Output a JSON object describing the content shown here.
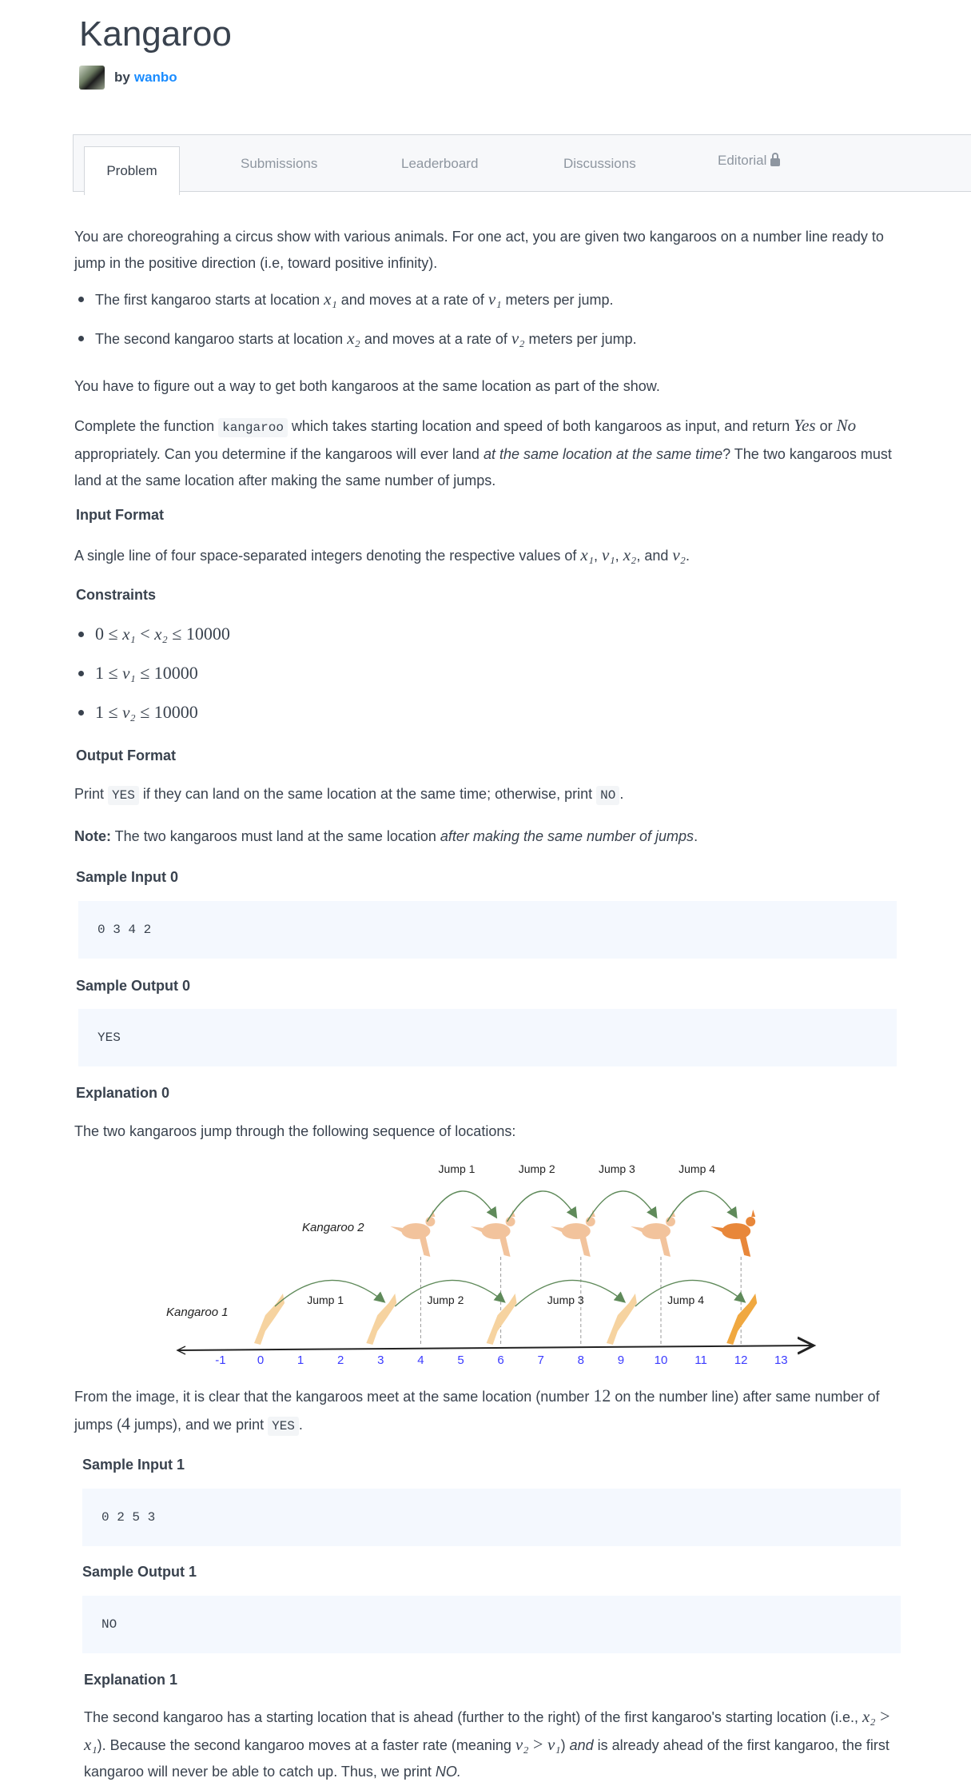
{
  "header": {
    "title": "Kangaroo",
    "by": "by",
    "author": "wanbo"
  },
  "tabs": [
    {
      "label": "Problem"
    },
    {
      "label": "Submissions"
    },
    {
      "label": "Leaderboard"
    },
    {
      "label": "Discussions"
    },
    {
      "label": "Editorial",
      "icon": "lock-icon"
    }
  ],
  "problem": {
    "intro": [
      {
        "t": "You are choreograhing a circus show with various animals. For one act, you are given two kangaroos on a number line ready to jump in the positive direction (i.e, toward positive infinity)."
      }
    ],
    "bullets": [
      [
        {
          "t": "The first kangaroo starts at location "
        },
        {
          "t": "x₁",
          "s": "m"
        },
        {
          "t": " and moves at a rate of "
        },
        {
          "t": "v₁",
          "s": "m"
        },
        {
          "t": " meters per jump."
        }
      ],
      [
        {
          "t": "The second kangaroo starts at location "
        },
        {
          "t": "x₂",
          "s": "m"
        },
        {
          "t": " and moves at a rate of "
        },
        {
          "t": "v₂",
          "s": "m"
        },
        {
          "t": " meters per jump."
        }
      ]
    ],
    "goal": [
      {
        "t": "You have to figure out a way to get both kangaroos at the same location as part of the show."
      }
    ],
    "task": [
      {
        "t": "Complete the function "
      },
      {
        "t": "kangaroo",
        "s": "code"
      },
      {
        "t": " which takes starting location and speed of both kangaroos as input, and return "
      },
      {
        "t": "Yes",
        "s": "m"
      },
      {
        "t": " or "
      },
      {
        "t": "No",
        "s": "m"
      },
      {
        "t": " appropriately. Can you determine if the kangaroos will ever land "
      },
      {
        "t": "at the same location at the same time",
        "s": "it"
      },
      {
        "t": "? The two kangaroos must land at the same location after making the same number of jumps."
      }
    ],
    "input_heading": "Input Format",
    "input_text": [
      {
        "t": "A single line of four space-separated integers denoting the respective values of "
      },
      {
        "t": "x₁",
        "s": "m"
      },
      {
        "t": ", "
      },
      {
        "t": "v₁",
        "s": "m"
      },
      {
        "t": ", "
      },
      {
        "t": "x₂",
        "s": "m"
      },
      {
        "t": ", and "
      },
      {
        "t": "v₂",
        "s": "m"
      },
      {
        "t": "."
      }
    ],
    "constraints_heading": "Constraints",
    "constraints": [
      [
        {
          "t": "0 ≤ ",
          "s": "mn"
        },
        {
          "t": "x₁",
          "s": "m"
        },
        {
          "t": " < ",
          "s": "mn"
        },
        {
          "t": "x₂",
          "s": "m"
        },
        {
          "t": " ≤ 10000",
          "s": "mn"
        }
      ],
      [
        {
          "t": "1 ≤ ",
          "s": "mn"
        },
        {
          "t": "v₁",
          "s": "m"
        },
        {
          "t": " ≤ 10000",
          "s": "mn"
        }
      ],
      [
        {
          "t": "1 ≤ ",
          "s": "mn"
        },
        {
          "t": "v₂",
          "s": "m"
        },
        {
          "t": " ≤ 10000",
          "s": "mn"
        }
      ]
    ],
    "output_heading": "Output Format",
    "output_text": [
      {
        "t": "Print "
      },
      {
        "t": "YES",
        "s": "code"
      },
      {
        "t": " if they can land on the same location at the same time; otherwise, print "
      },
      {
        "t": "NO",
        "s": "code"
      },
      {
        "t": "."
      }
    ],
    "note": [
      {
        "t": "Note:",
        "s": "b"
      },
      {
        "t": " The two kangaroos must land at the same location "
      },
      {
        "t": "after making the same number of jumps",
        "s": "it"
      },
      {
        "t": "."
      }
    ],
    "sample_input_0_heading": "Sample Input 0",
    "sample_input_0": "0 3 4 2",
    "sample_output_0_heading": "Sample Output 0",
    "sample_output_0": "YES",
    "explanation_0_heading": "Explanation 0",
    "explanation_0_intro": [
      {
        "t": "The two kangaroos jump through the following sequence of locations:"
      }
    ],
    "explanation_0_after": [
      {
        "t": "From the image, it is clear that the kangaroos meet at the same location (number "
      },
      {
        "t": "12",
        "s": "mn"
      },
      {
        "t": " on the number line) after same number of jumps ("
      },
      {
        "t": "4",
        "s": "mn"
      },
      {
        "t": " jumps), and we print "
      },
      {
        "t": "YES",
        "s": "code"
      },
      {
        "t": "."
      }
    ],
    "sample_input_1_heading": "Sample Input 1",
    "sample_input_1": "0 2 5 3",
    "sample_output_1_heading": "Sample Output 1",
    "sample_output_1": "NO",
    "explanation_1_heading": "Explanation 1",
    "explanation_1": [
      {
        "t": "The second kangaroo has a starting location that is ahead (further to the right) of the first kangaroo's starting location (i.e., "
      },
      {
        "t": "x₂",
        "s": "m"
      },
      {
        "t": " > ",
        "s": "mn"
      },
      {
        "t": "x₁",
        "s": "m"
      },
      {
        "t": "). Because the second kangaroo moves at a faster rate (meaning "
      },
      {
        "t": "v₂",
        "s": "m"
      },
      {
        "t": " > ",
        "s": "mn"
      },
      {
        "t": "v₁",
        "s": "m"
      },
      {
        "t": ") "
      },
      {
        "t": "and",
        "s": "it"
      },
      {
        "t": " is already ahead of the first kangaroo, the first kangaroo will never be able to catch up. Thus, we print "
      },
      {
        "t": "NO.",
        "s": "it"
      }
    ]
  },
  "diagram": {
    "kangaroo1_label": "Kangaroo 1",
    "kangaroo2_label": "Kangaroo 2",
    "kangaroo1_positions": [
      0,
      3,
      6,
      9,
      12
    ],
    "kangaroo2_positions": [
      4,
      6,
      8,
      10,
      12
    ],
    "jump_labels": [
      "Jump 1",
      "Jump 2",
      "Jump 3",
      "Jump 4"
    ],
    "ticks": [
      "-1",
      "0",
      "1",
      "2",
      "3",
      "4",
      "5",
      "6",
      "7",
      "8",
      "9",
      "10",
      "11",
      "12",
      "13"
    ],
    "colors": {
      "tick": "#3b3bff",
      "arrow": "#5f8a5a",
      "kangaroo1": "#f6d3a0",
      "kangaroo1_final": "#f0a840",
      "kangaroo2": "#f2c39c",
      "kangaroo2_final": "#e8873a"
    }
  }
}
